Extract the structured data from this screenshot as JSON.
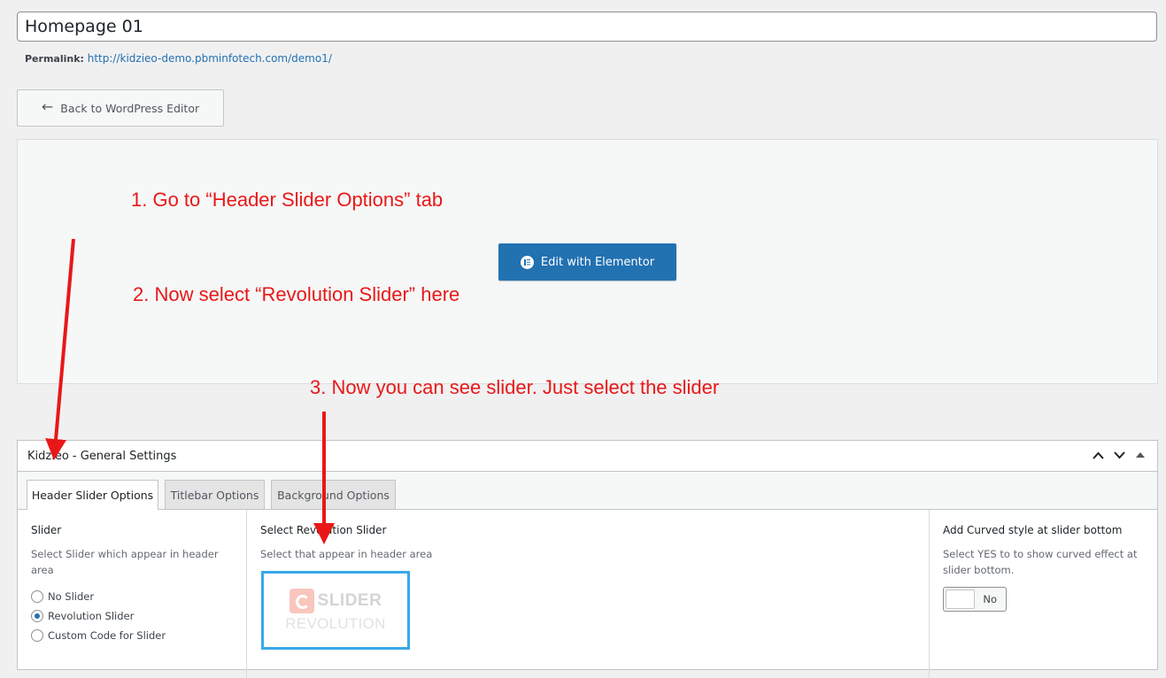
{
  "page": {
    "title_value": "Homepage 01",
    "permalink_label": "Permalink:",
    "permalink_url": "http://kidzieo-demo.pbminfotech.com/demo1/",
    "back_button": "Back to WordPress Editor",
    "elementor_button": "Edit with Elementor"
  },
  "annotations": {
    "step1": "1. Go to “Header Slider Options” tab",
    "step2": "2. Now select “Revolution Slider” here",
    "step3": "3. Now you can see slider. Just select the slider",
    "color": "#e81818"
  },
  "metabox": {
    "title": "Kidzieo - General Settings",
    "tabs": [
      {
        "label": "Header Slider Options",
        "active": true
      },
      {
        "label": "Titlebar Options",
        "active": false
      },
      {
        "label": "Background Options",
        "active": false
      }
    ],
    "slider": {
      "label": "Slider",
      "description": "Select Slider which appear in header area",
      "options": [
        {
          "label": "No Slider",
          "selected": false
        },
        {
          "label": "Revolution Slider",
          "selected": true
        },
        {
          "label": "Custom Code for Slider",
          "selected": false
        }
      ]
    },
    "revolution": {
      "label": "Select Revolution Slider",
      "description": "Select that appear in header area",
      "thumb_top": "SLIDER",
      "thumb_bottom": "REVOLUTION"
    },
    "curved": {
      "label": "Add Curved style at slider bottom",
      "description": "Select YES to to show curved effect at slider bottom.",
      "toggle_value": "No"
    }
  },
  "colors": {
    "accent": "#2271b1",
    "highlight": "#39a9e6"
  }
}
